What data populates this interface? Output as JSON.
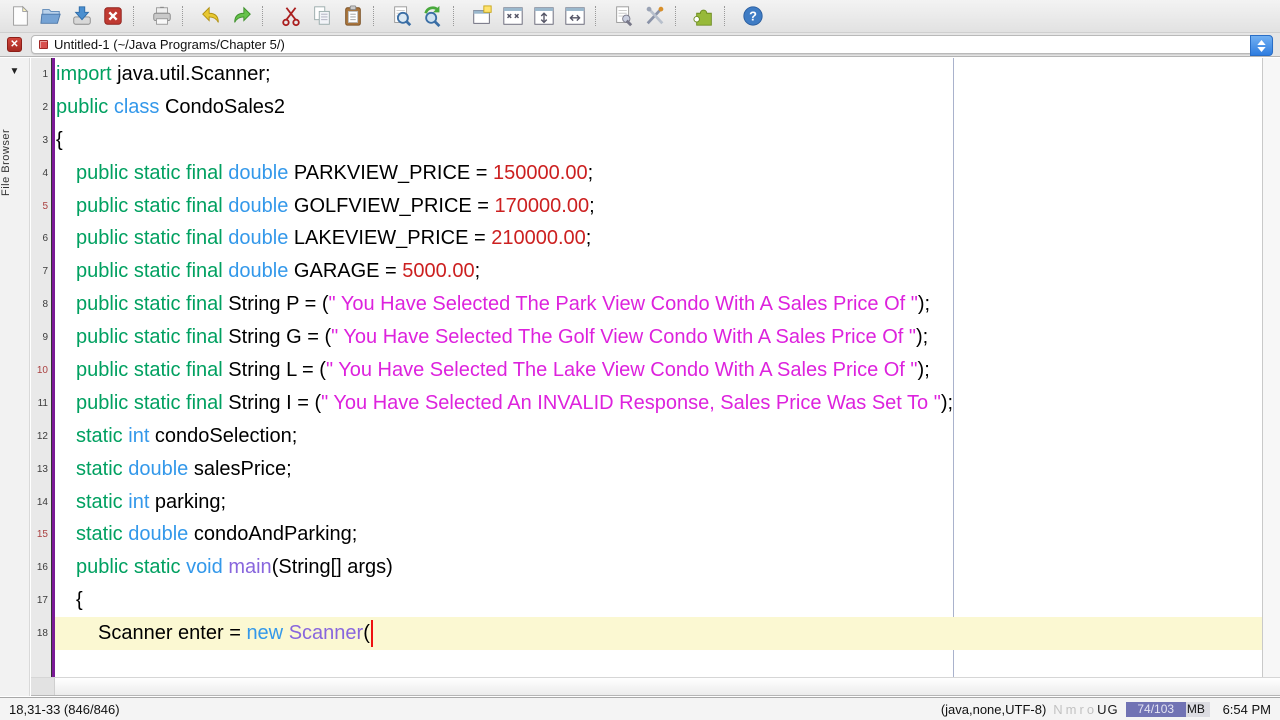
{
  "toolbar": {
    "items": [
      {
        "icon": "new-file"
      },
      {
        "icon": "open-file"
      },
      {
        "icon": "save-file"
      },
      {
        "icon": "close-buffer"
      },
      {
        "sep": true
      },
      {
        "icon": "print"
      },
      {
        "sep": true
      },
      {
        "icon": "undo"
      },
      {
        "icon": "redo"
      },
      {
        "sep": true
      },
      {
        "icon": "cut"
      },
      {
        "icon": "copy"
      },
      {
        "icon": "paste"
      },
      {
        "sep": true
      },
      {
        "icon": "find"
      },
      {
        "icon": "find-next"
      },
      {
        "sep": true
      },
      {
        "icon": "new-view"
      },
      {
        "icon": "unsplit"
      },
      {
        "icon": "split-horizontal"
      },
      {
        "icon": "split-vertical"
      },
      {
        "sep": true
      },
      {
        "icon": "buffer-options"
      },
      {
        "icon": "global-options"
      },
      {
        "sep": true
      },
      {
        "icon": "plugin-manager"
      },
      {
        "sep": true
      },
      {
        "icon": "help"
      }
    ]
  },
  "buffer_bar": {
    "title": "Untitled-1 (~/Java Programs/Chapter 5/)"
  },
  "dock": {
    "label": "File Browser"
  },
  "editor": {
    "colors": {
      "keyword": "#00a060",
      "type": "#3398ea",
      "function": "#8866dd",
      "number": "#cc2020",
      "string": "#dd22dd",
      "plain": "#000000"
    },
    "caret_line": 18,
    "lines": [
      {
        "n": 1,
        "indent": 0,
        "tokens": [
          [
            "k",
            "import"
          ],
          [
            "p",
            " java.util.Scanner;"
          ]
        ]
      },
      {
        "n": 2,
        "indent": 0,
        "tokens": [
          [
            "k",
            "public "
          ],
          [
            "t",
            "class"
          ],
          [
            "p",
            " CondoSales2"
          ]
        ]
      },
      {
        "n": 3,
        "indent": 0,
        "tokens": [
          [
            "p",
            "{"
          ]
        ]
      },
      {
        "n": 4,
        "indent": 1,
        "tokens": [
          [
            "k",
            "public static final "
          ],
          [
            "t",
            "double"
          ],
          [
            "p",
            " PARKVIEW_PRICE = "
          ],
          [
            "n",
            "150000.00"
          ],
          [
            "p",
            ";"
          ]
        ]
      },
      {
        "n": 5,
        "indent": 1,
        "tokens": [
          [
            "k",
            "public static final "
          ],
          [
            "t",
            "double"
          ],
          [
            "p",
            " GOLFVIEW_PRICE = "
          ],
          [
            "n",
            "170000.00"
          ],
          [
            "p",
            ";"
          ]
        ]
      },
      {
        "n": 6,
        "indent": 1,
        "tokens": [
          [
            "k",
            "public static final "
          ],
          [
            "t",
            "double"
          ],
          [
            "p",
            " LAKEVIEW_PRICE = "
          ],
          [
            "n",
            "210000.00"
          ],
          [
            "p",
            ";"
          ]
        ]
      },
      {
        "n": 7,
        "indent": 1,
        "tokens": [
          [
            "k",
            "public static final "
          ],
          [
            "t",
            "double"
          ],
          [
            "p",
            " GARAGE = "
          ],
          [
            "n",
            "5000.00"
          ],
          [
            "p",
            ";"
          ]
        ]
      },
      {
        "n": 8,
        "indent": 1,
        "tokens": [
          [
            "k",
            "public static final "
          ],
          [
            "p",
            "String P = ("
          ],
          [
            "s",
            "\" You Have Selected The Park View Condo With A Sales Price Of \""
          ],
          [
            "p",
            ");"
          ]
        ]
      },
      {
        "n": 9,
        "indent": 1,
        "tokens": [
          [
            "k",
            "public static final "
          ],
          [
            "p",
            "String G = ("
          ],
          [
            "s",
            "\" You Have Selected The Golf View Condo With A Sales Price Of \""
          ],
          [
            "p",
            ");"
          ]
        ]
      },
      {
        "n": 10,
        "indent": 1,
        "tokens": [
          [
            "k",
            "public static final "
          ],
          [
            "p",
            "String L = ("
          ],
          [
            "s",
            "\" You Have Selected The Lake View Condo With A Sales Price Of \""
          ],
          [
            "p",
            ");"
          ]
        ]
      },
      {
        "n": 11,
        "indent": 1,
        "tokens": [
          [
            "k",
            "public static final "
          ],
          [
            "p",
            "String I = ("
          ],
          [
            "s",
            "\" You Have Selected An INVALID Response, Sales Price Was Set To \""
          ],
          [
            "p",
            ");"
          ]
        ]
      },
      {
        "n": 12,
        "indent": 1,
        "tokens": [
          [
            "k",
            "static "
          ],
          [
            "t",
            "int"
          ],
          [
            "p",
            " condoSelection;"
          ]
        ]
      },
      {
        "n": 13,
        "indent": 1,
        "tokens": [
          [
            "k",
            "static "
          ],
          [
            "t",
            "double"
          ],
          [
            "p",
            " salesPrice;"
          ]
        ]
      },
      {
        "n": 14,
        "indent": 1,
        "tokens": [
          [
            "k",
            "static "
          ],
          [
            "t",
            "int"
          ],
          [
            "p",
            " parking;"
          ]
        ]
      },
      {
        "n": 15,
        "indent": 1,
        "tokens": [
          [
            "k",
            "static "
          ],
          [
            "t",
            "double"
          ],
          [
            "p",
            " condoAndParking;"
          ]
        ]
      },
      {
        "n": 16,
        "indent": 1,
        "tokens": [
          [
            "k",
            "public static "
          ],
          [
            "t",
            "void"
          ],
          [
            "p",
            " "
          ],
          [
            "f",
            "main"
          ],
          [
            "p",
            "(String[] args)"
          ]
        ]
      },
      {
        "n": 17,
        "indent": 1,
        "tokens": [
          [
            "p",
            "{"
          ]
        ]
      },
      {
        "n": 18,
        "indent": 2,
        "tokens": [
          [
            "p",
            "Scanner enter = "
          ],
          [
            "t",
            "new"
          ],
          [
            "p",
            " "
          ],
          [
            "f",
            "Scanner"
          ],
          [
            "p",
            "("
          ]
        ]
      }
    ]
  },
  "status_bar": {
    "caret_position": "18,31-33 (846/846)",
    "mode": "(java,none,UTF-8)",
    "flags_dim": "Nmro",
    "flags_lit": "UG",
    "memory": {
      "used": 74,
      "total": 103,
      "label": "74/103",
      "unit": "MB"
    },
    "time": "6:54 PM"
  }
}
